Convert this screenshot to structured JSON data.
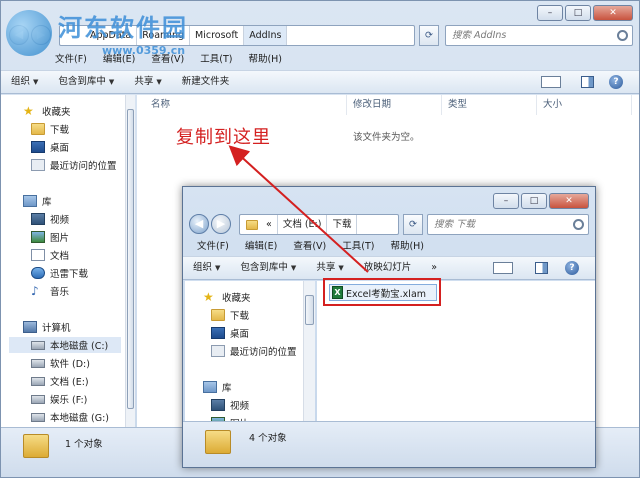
{
  "watermark": {
    "title": "河东软件园",
    "url": "www.0359.cn"
  },
  "outer": {
    "breadcrumbs": [
      "AppData",
      "Roaming",
      "Microsoft",
      "AddIns"
    ],
    "search_placeholder": "搜索 AddIns",
    "menu": [
      "文件(F)",
      "编辑(E)",
      "查看(V)",
      "工具(T)",
      "帮助(H)"
    ],
    "commands": [
      "组织",
      "包含到库中",
      "共享",
      "新建文件夹"
    ],
    "columns": [
      "名称",
      "修改日期",
      "类型",
      "大小"
    ],
    "empty_text": "该文件夹为空。",
    "nav": {
      "favorites": "收藏夹",
      "downloads": "下载",
      "desktop": "桌面",
      "recent": "最近访问的位置",
      "library": "库",
      "videos": "视频",
      "pictures": "图片",
      "documents": "文档",
      "thunder": "迅雷下载",
      "music": "音乐",
      "computer": "计算机",
      "drive_c": "本地磁盘 (C:)",
      "drive_d": "软件 (D:)",
      "drive_e": "文档 (E:)",
      "drive_f": "娱乐 (F:)",
      "drive_g": "本地磁盘 (G:)"
    },
    "status": "1 个对象"
  },
  "annotation": "复制到这里",
  "inner": {
    "breadcrumbs": [
      "«",
      "文档 (E:)",
      "下载"
    ],
    "search_placeholder": "搜索 下载",
    "menu": [
      "文件(F)",
      "编辑(E)",
      "查看(V)",
      "工具(T)",
      "帮助(H)"
    ],
    "commands": [
      "组织",
      "包含到库中",
      "共享",
      "放映幻灯片",
      "»"
    ],
    "file_name": "Excel考勤宝.xlam",
    "nav": {
      "favorites": "收藏夹",
      "downloads": "下载",
      "desktop": "桌面",
      "recent": "最近访问的位置",
      "library": "库",
      "videos": "视频",
      "pictures": "图片"
    },
    "status": "4 个对象"
  },
  "colors": {
    "accent": "#3d8fd8",
    "annotation": "#d42020"
  },
  "icons": {
    "back": "back-arrow-icon",
    "forward": "forward-arrow-icon",
    "refresh": "refresh-icon",
    "search": "search-icon",
    "help": "help-icon",
    "preview": "preview-pane-icon"
  }
}
